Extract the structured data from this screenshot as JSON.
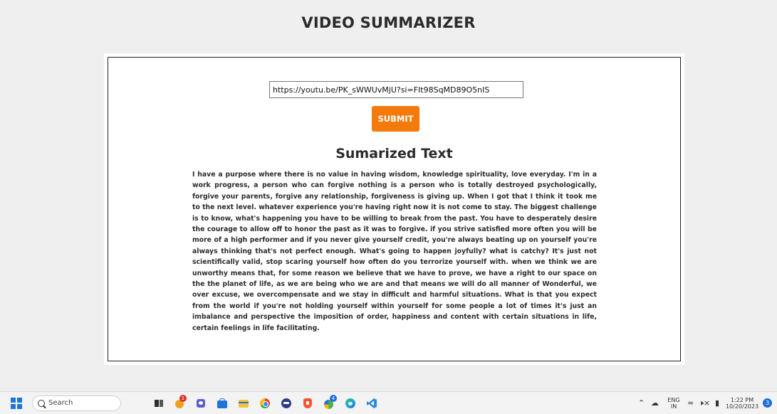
{
  "app": {
    "title": "VIDEO SUMMARIZER"
  },
  "form": {
    "url_value": "https://youtu.be/PK_sWWUvMjU?si=FIt98SqMD89O5nIS",
    "submit_label": "SUBMIT"
  },
  "summary": {
    "heading": "Sumarized Text",
    "text": "I have a purpose where there is no value in having wisdom, knowledge spirituality, love everyday. I'm in a work progress, a person who can forgive nothing is a person who is totally destroyed psychologically, forgive your parents, forgive any relationship, forgiveness is giving up. When I got that I think it took me to the next level. whatever experience you're having right now it is not come to stay. The biggest challenge is to know, what's happening you have to be willing to break from the past. You have to desperately desire the courage to allow off to honor the past as it was to forgive. if you strive satisfied more often you will be more of a high performer and if you never give yourself credit, you're always beating up on yourself you're always thinking that's not perfect enough. What's going to happen joyfully? what is catchy? It's just not scientifically valid, stop scaring yourself how often do you terrorize yourself with. when we think we are unworthy means that, for some reason we believe that we have to prove, we have a right to our space on the the planet of life, as we are being who we are and that means we will do all manner of Wonderful, we over excuse, we overcompensate and we stay in difficult and harmful situations. What is that you expect from the world if you're not holding yourself within yourself for some people a lot of times it's just an imbalance and perspective the imposition of order, happiness and content with certain situations in life, certain feelings in life facilitating."
  },
  "taskbar": {
    "search_label": "Search",
    "pinned_icons": [
      {
        "name": "task-view-icon",
        "color": "#2c2c2c"
      },
      {
        "name": "app-icon-badge",
        "color": "#f0a020",
        "badge": "1"
      },
      {
        "name": "chat-icon",
        "color": "#5b5fc7"
      },
      {
        "name": "store-icon",
        "color": "#1e74d8"
      },
      {
        "name": "file-explorer-icon",
        "color": "#f3c13a"
      },
      {
        "name": "chrome-icon",
        "color": "#e94235"
      },
      {
        "name": "media-icon",
        "color": "#2d3a8c"
      },
      {
        "name": "brave-icon",
        "color": "#fb542b"
      },
      {
        "name": "app-icon-notification",
        "color": "#4caf50",
        "badge": "4"
      },
      {
        "name": "edge-icon",
        "color": "#1f9fd8"
      },
      {
        "name": "vscode-icon",
        "color": "#2a8cdb"
      }
    ],
    "tray": {
      "language": "ENG",
      "region": "IN",
      "time": "1:22 PM",
      "date": "10/20/2023",
      "notifications": "3"
    }
  }
}
